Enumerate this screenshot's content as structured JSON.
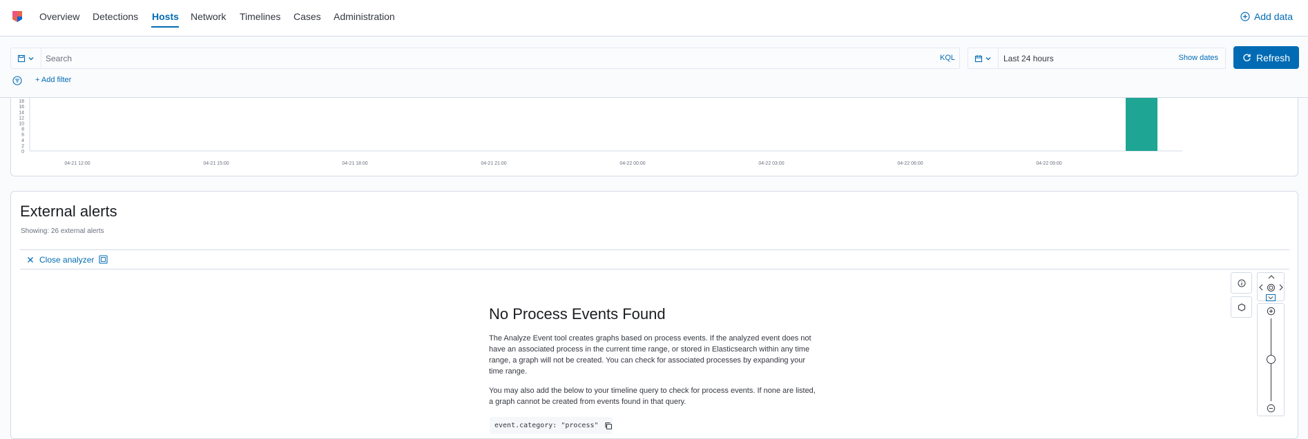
{
  "nav": {
    "tabs": [
      "Overview",
      "Detections",
      "Hosts",
      "Network",
      "Timelines",
      "Cases",
      "Administration"
    ],
    "active_tab": "Hosts",
    "add_data": "Add data"
  },
  "query_bar": {
    "search_placeholder": "Search",
    "language": "KQL",
    "date_range": "Last 24 hours",
    "show_dates": "Show dates",
    "refresh": "Refresh",
    "add_filter": "+ Add filter"
  },
  "chart_data": {
    "type": "bar",
    "y_ticks": [
      "0",
      "2",
      "4",
      "6",
      "8",
      "10",
      "12",
      "14",
      "16",
      "18"
    ],
    "x_ticks": [
      "04-21 12:00",
      "04-21 15:00",
      "04-21 18:00",
      "04-21 21:00",
      "04-22 00:00",
      "04-22 03:00",
      "04-22 06:00",
      "04-22 09:00"
    ],
    "bars": [
      {
        "x": "04-22 11:00",
        "value": 26
      }
    ],
    "ylim": [
      0,
      18
    ],
    "bar_color": "#1ea593"
  },
  "alerts": {
    "title": "External alerts",
    "subtitle": "Showing: 26 external alerts",
    "close_analyzer": "Close analyzer"
  },
  "analyzer": {
    "empty_title": "No Process Events Found",
    "para1": "The Analyze Event tool creates graphs based on process events. If the analyzed event does not have an associated process in the current time range, or stored in Elasticsearch within any time range, a graph will not be created. You can check for associated processes by expanding your time range.",
    "para2": "You may also add the below to your timeline query to check for process events. If none are listed, a graph cannot be created from events found in that query.",
    "code": "event.category: \"process\""
  },
  "colors": {
    "accent": "#006bb4",
    "bar": "#1ea593"
  }
}
